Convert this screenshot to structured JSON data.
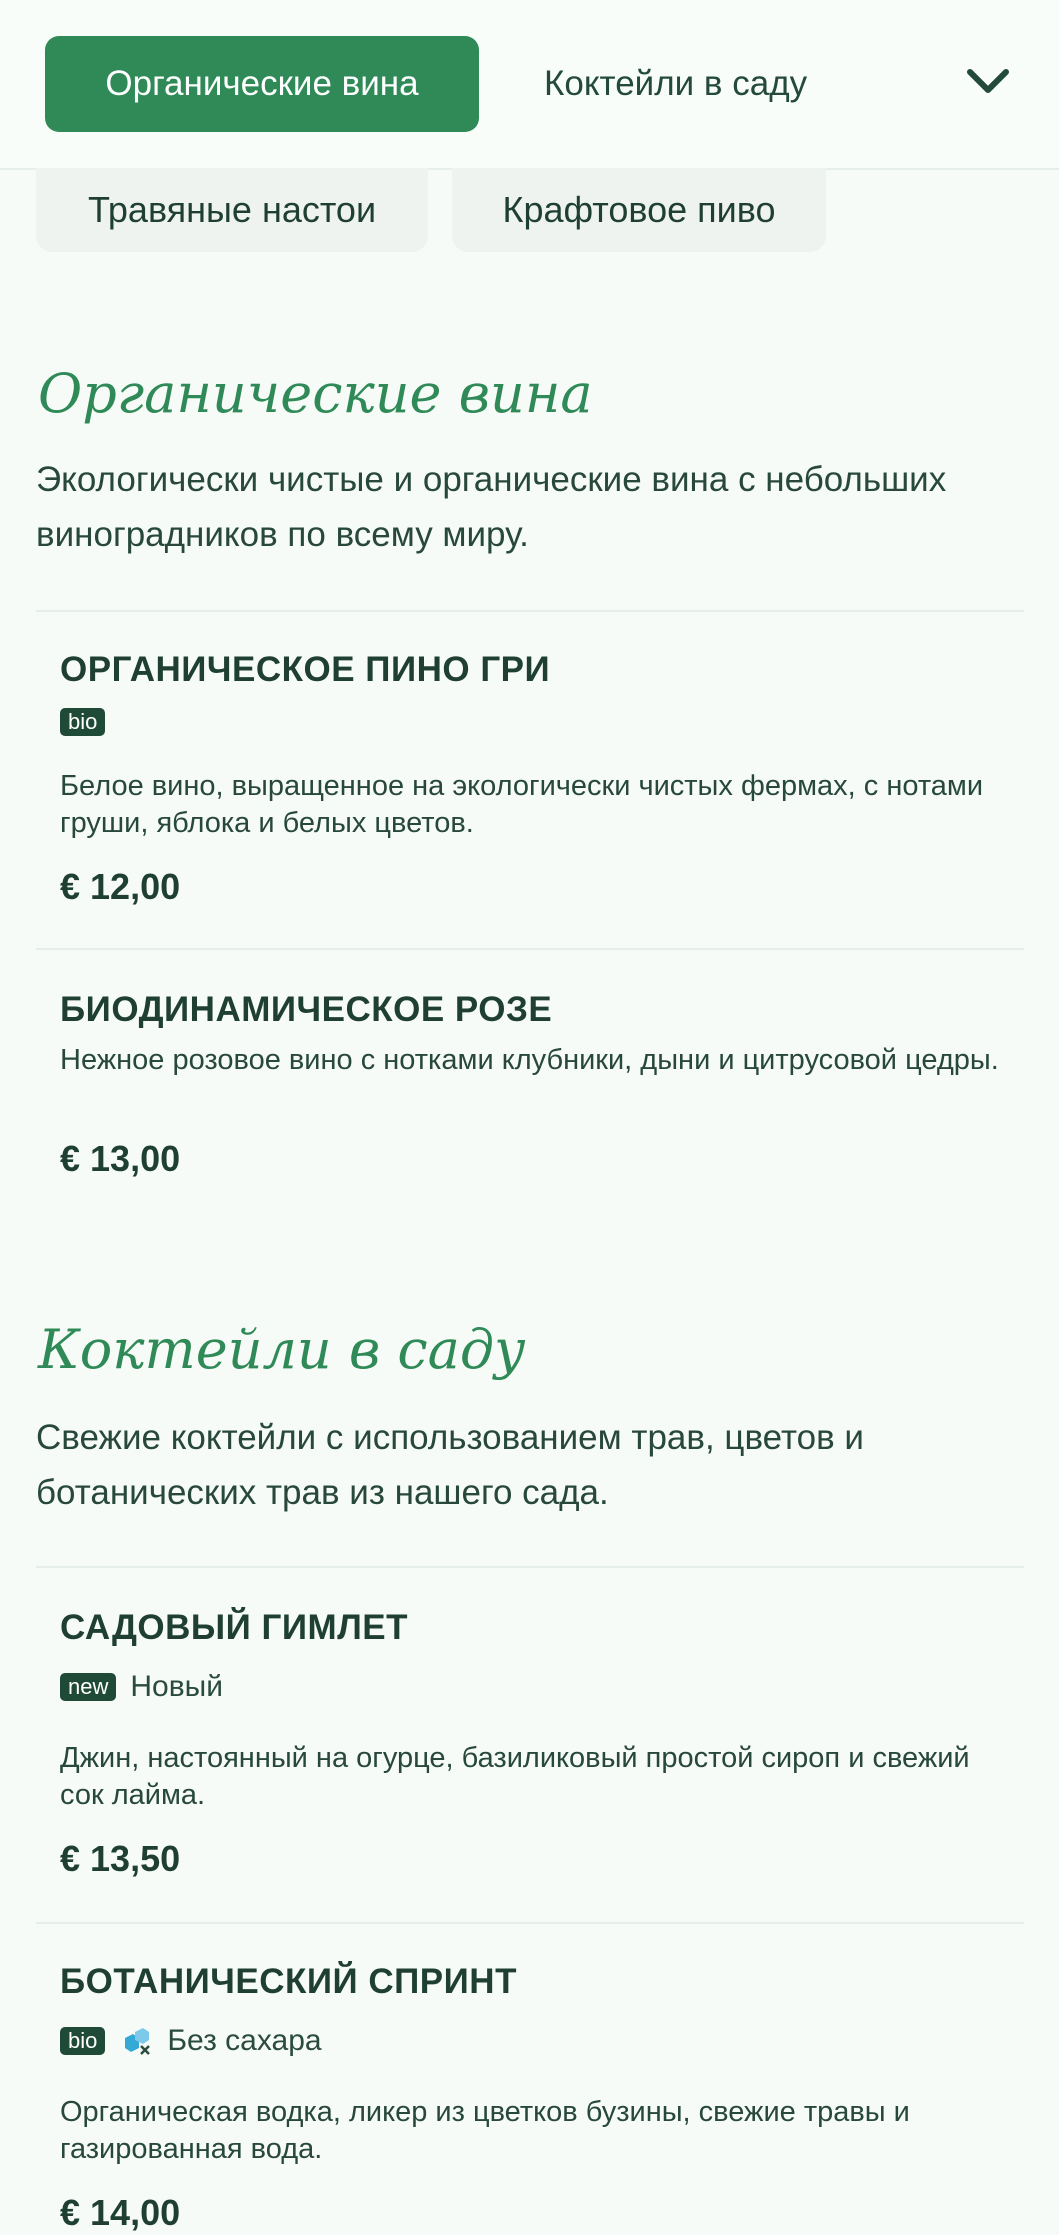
{
  "nav": {
    "tabs": [
      {
        "label": "Органические вина",
        "active": true
      },
      {
        "label": "Коктейли в саду",
        "active": false
      }
    ],
    "more_icon": "chevron-down-icon",
    "chips": [
      {
        "label": "Травяные настои"
      },
      {
        "label": "Крафтовое пиво"
      }
    ]
  },
  "sections": [
    {
      "title": "Органические вина",
      "description": "Экологически чистые и органические вина с небольших виноградников по всему миру.",
      "items": [
        {
          "name": "ОРГАНИЧЕСКОЕ ПИНО ГРИ",
          "badges": [
            {
              "tag": "bio",
              "label": ""
            }
          ],
          "description": "Белое вино, выращенное на экологически чистых фермах, с нотами груши, яблока и белых цветов.",
          "price": "€ 12,00"
        },
        {
          "name": "БИОДИНАМИЧЕСКОЕ РОЗЕ",
          "badges": [],
          "description": "Нежное розовое вино с нотками клубники, дыни и цитрусовой цедры.",
          "price": "€ 13,00"
        }
      ]
    },
    {
      "title": "Коктейли в саду",
      "description": "Свежие коктейли с использованием трав, цветов и ботанических трав из нашего сада.",
      "items": [
        {
          "name": "САДОВЫЙ ГИМЛЕТ",
          "badges": [
            {
              "tag": "new",
              "label": "Новый"
            }
          ],
          "description": "Джин, настоянный на огурце, базиликовый простой сироп и свежий сок лайма.",
          "price": "€ 13,50"
        },
        {
          "name": "БОТАНИЧЕСКИЙ СПРИНТ",
          "badges": [
            {
              "tag": "bio",
              "label": ""
            },
            {
              "icon": "sugar-free-icon",
              "label": "Без сахара"
            }
          ],
          "description": "Органическая водка, ликер из цветков бузины, свежие травы и газированная вода.",
          "price": "€ 14,00"
        }
      ]
    }
  ],
  "colors": {
    "accent": "#2f8a57",
    "badge_bg": "#1f4a38",
    "background": "#f6fbf8",
    "sugar_icon": "#35a9d6"
  }
}
